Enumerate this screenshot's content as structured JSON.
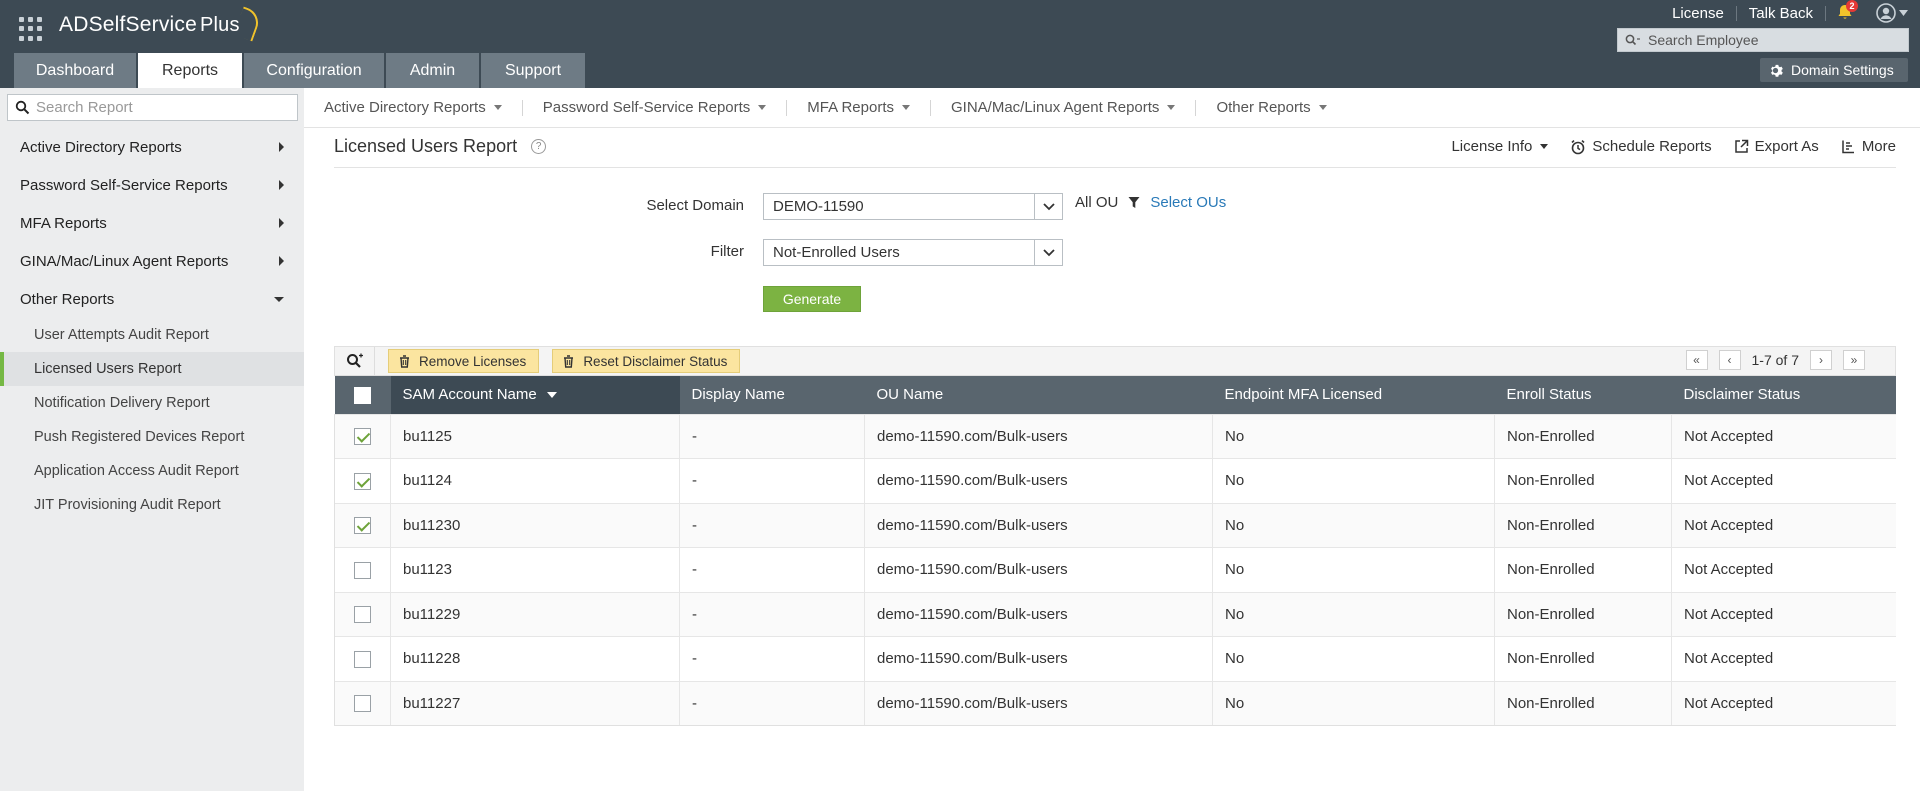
{
  "header": {
    "app_name": "ADSelfService",
    "app_suffix": "Plus",
    "links": [
      "License",
      "Talk Back"
    ],
    "notification_count": "2",
    "search_placeholder": "Search Employee",
    "domain_settings": "Domain Settings",
    "tabs": [
      {
        "label": "Dashboard",
        "active": false
      },
      {
        "label": "Reports",
        "active": true
      },
      {
        "label": "Configuration",
        "active": false
      },
      {
        "label": "Admin",
        "active": false
      },
      {
        "label": "Support",
        "active": false
      }
    ]
  },
  "sidebar": {
    "search_placeholder": "Search Report",
    "items": [
      {
        "label": "Active Directory Reports"
      },
      {
        "label": "Password Self-Service Reports"
      },
      {
        "label": "MFA Reports"
      },
      {
        "label": "GINA/Mac/Linux Agent Reports"
      },
      {
        "label": "Other Reports"
      }
    ],
    "sub_items": [
      {
        "label": "User Attempts Audit Report"
      },
      {
        "label": "Licensed Users Report"
      },
      {
        "label": "Notification Delivery Report"
      },
      {
        "label": "Push Registered Devices Report"
      },
      {
        "label": "Application Access Audit Report"
      },
      {
        "label": "JIT Provisioning Audit Report"
      }
    ]
  },
  "subnav": {
    "items": [
      "Active Directory Reports",
      "Password Self-Service Reports",
      "MFA Reports",
      "GINA/Mac/Linux Agent Reports",
      "Other Reports"
    ]
  },
  "report": {
    "title": "Licensed Users Report",
    "help_icon": "?",
    "actions": {
      "license_info": "License Info",
      "schedule": "Schedule Reports",
      "export": "Export As",
      "more": "More"
    }
  },
  "form": {
    "domain_label": "Select Domain",
    "domain_value": "DEMO-11590",
    "filter_label": "Filter",
    "filter_value": "Not-Enrolled Users",
    "ou_label": "All OU",
    "select_ous": "Select OUs",
    "generate": "Generate"
  },
  "toolbar": {
    "remove_licenses": "Remove Licenses",
    "reset_disclaimer": "Reset Disclaimer Status",
    "page_info": "1-7 of 7"
  },
  "table": {
    "columns": [
      "SAM Account Name",
      "Display Name",
      "OU Name",
      "Endpoint MFA Licensed",
      "Enroll Status",
      "Disclaimer Status"
    ],
    "rows": [
      {
        "checked": true,
        "sam": "bu1125",
        "display": "-",
        "ou": "demo-11590.com/Bulk-users",
        "mfa": "No",
        "enroll": "Non-Enrolled",
        "disclaimer": "Not Accepted"
      },
      {
        "checked": true,
        "sam": "bu1124",
        "display": "-",
        "ou": "demo-11590.com/Bulk-users",
        "mfa": "No",
        "enroll": "Non-Enrolled",
        "disclaimer": "Not Accepted"
      },
      {
        "checked": true,
        "sam": "bu11230",
        "display": "-",
        "ou": "demo-11590.com/Bulk-users",
        "mfa": "No",
        "enroll": "Non-Enrolled",
        "disclaimer": "Not Accepted"
      },
      {
        "checked": false,
        "sam": "bu1123",
        "display": "-",
        "ou": "demo-11590.com/Bulk-users",
        "mfa": "No",
        "enroll": "Non-Enrolled",
        "disclaimer": "Not Accepted"
      },
      {
        "checked": false,
        "sam": "bu11229",
        "display": "-",
        "ou": "demo-11590.com/Bulk-users",
        "mfa": "No",
        "enroll": "Non-Enrolled",
        "disclaimer": "Not Accepted"
      },
      {
        "checked": false,
        "sam": "bu11228",
        "display": "-",
        "ou": "demo-11590.com/Bulk-users",
        "mfa": "No",
        "enroll": "Non-Enrolled",
        "disclaimer": "Not Accepted"
      },
      {
        "checked": false,
        "sam": "bu11227",
        "display": "-",
        "ou": "demo-11590.com/Bulk-users",
        "mfa": "No",
        "enroll": "Non-Enrolled",
        "disclaimer": "Not Accepted"
      }
    ]
  },
  "colors": {
    "header_bg": "#3d4a54",
    "tab_bg": "#6e7b85",
    "accent_green": "#7cb342",
    "button_yellow": "#fbe5a0",
    "link_blue": "#2a7ab8"
  }
}
